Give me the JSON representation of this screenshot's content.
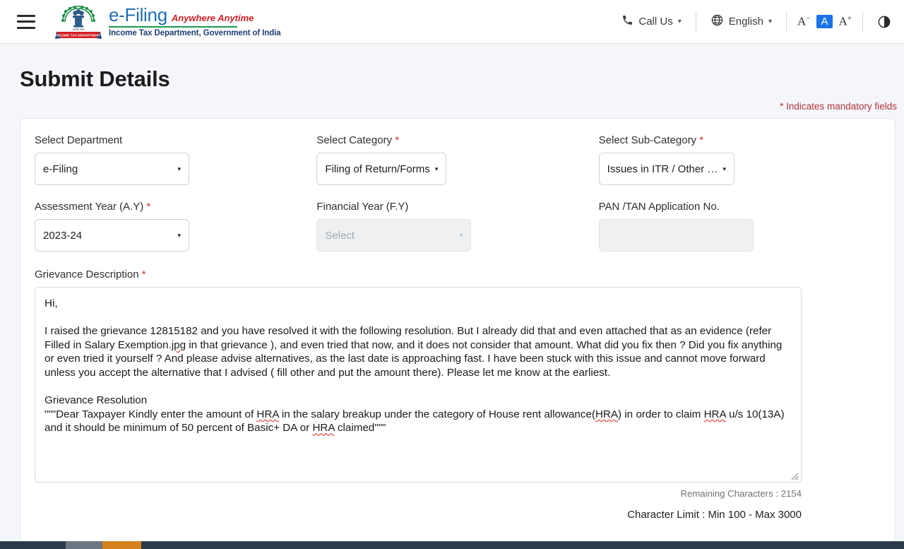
{
  "header": {
    "menu_icon": "hamburger-menu-icon",
    "logo": {
      "emblem_alt": "india-national-emblem-income-tax-department",
      "title": "e-Filing",
      "tagline": "Anywhere Anytime",
      "subtitle": "Income Tax Department, Government of India",
      "banner_text": "INCOME TAX DEPARTMENT"
    },
    "call_us": {
      "label": "Call Us",
      "icon": "phone-icon",
      "caret": "⌄"
    },
    "language": {
      "label": "English",
      "icon": "globe-icon",
      "caret": "⌄"
    },
    "font_size": {
      "decrease": "A",
      "decrease_sup": "−",
      "normal": "A",
      "increase": "A",
      "increase_sup": "+"
    },
    "contrast_icon": "contrast-icon"
  },
  "page": {
    "title": "Submit Details",
    "mandatory_note": "* Indicates mandatory fields"
  },
  "form": {
    "department": {
      "label": "Select Department",
      "required": false,
      "value": "e-Filing",
      "caret": "▾"
    },
    "category": {
      "label": "Select Category",
      "required": true,
      "required_mark": "*",
      "value": "Filing of Return/Forms",
      "caret": "▾"
    },
    "sub_category": {
      "label": "Select Sub-Category",
      "required": true,
      "required_mark": "*",
      "value": "Issues in ITR / Other …",
      "caret": "▾"
    },
    "assessment_year": {
      "label": "Assessment Year (A.Y)",
      "required": true,
      "required_mark": "*",
      "value": "2023-24",
      "caret": "▾"
    },
    "financial_year": {
      "label": "Financial Year (F.Y)",
      "required": false,
      "placeholder": "Select",
      "value": "",
      "disabled": true,
      "caret": "▾"
    },
    "pan_tan": {
      "label": "PAN /TAN Application No.",
      "required": false,
      "value": "",
      "placeholder": "",
      "disabled": true
    },
    "grievance_description": {
      "label": "Grievance Description",
      "required": true,
      "required_mark": "*",
      "lines": {
        "greeting": "Hi,",
        "para1_a": "I raised the grievance 12815182 and you have resolved it with the following resolution. But I already did that and even attached that as an evidence (refer Filled in Salary Exemption.",
        "para1_sp1": "jpg",
        "para1_b": " in that grievance ), and even tried that now, and it does not consider that amount. What did you fix then ? Did you fix anything or even tried it yourself ? And please advise alternatives, as the last date is approaching fast. I have been stuck with this issue and cannot move forward unless you accept the alternative that I advised ( fill other and put the amount there). Please let me know at the earliest.",
        "res_heading": "Grievance Resolution",
        "res_a": "\"\"\"Dear Taxpayer Kindly enter the amount of ",
        "res_sp1": "HRA",
        "res_b": " in the salary breakup under the category of House rent allowance(",
        "res_sp2": "HRA",
        "res_c": ") in order to claim ",
        "res_sp3": "HRA",
        "res_d": " u/s 10(13A) and it should be minimum of 50 percent of Basic+ DA or ",
        "res_sp4": "HRA",
        "res_e": " claimed\"\"\""
      },
      "resize_grip": "resize-grip-icon"
    },
    "remaining_characters": "Remaining Characters : 2154",
    "character_limit": "Character Limit : Min 100 - Max 3000"
  },
  "colors": {
    "brand_blue": "#1f6fb2",
    "brand_red": "#cf2026",
    "brand_green": "#1a9c4a",
    "accent_blue": "#1a73e8",
    "required_red": "#d0342c",
    "page_bg": "#f4f6fa",
    "taskbar_bg": "#2b3a4a",
    "taskbar_seg_grey": "#6b7782",
    "taskbar_seg_orange": "#d4811f"
  }
}
